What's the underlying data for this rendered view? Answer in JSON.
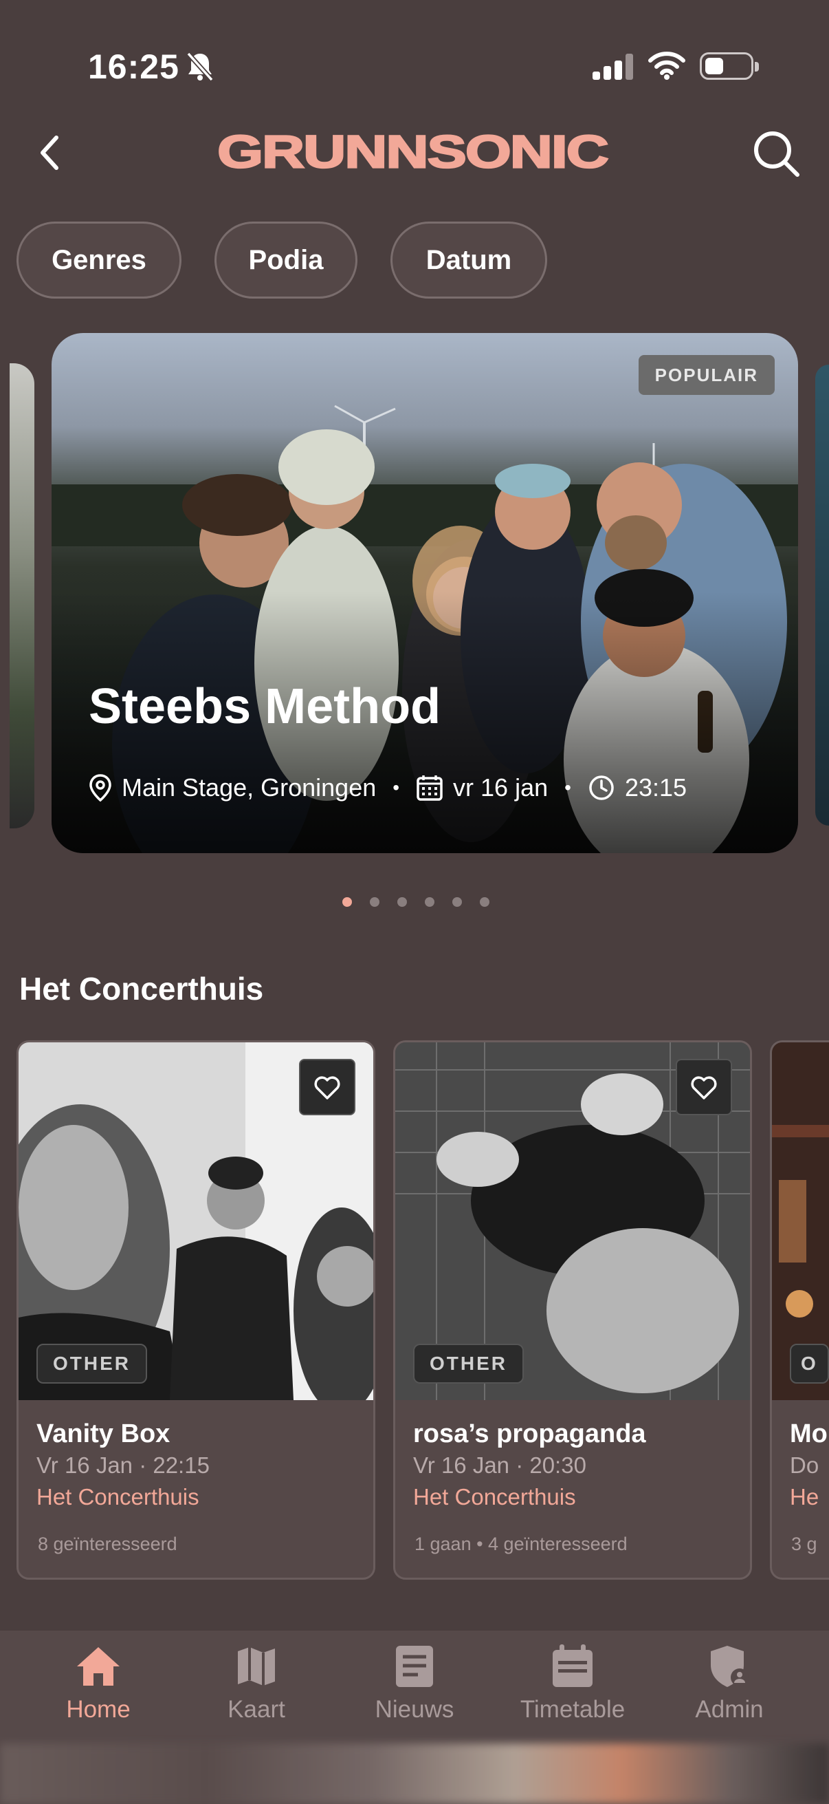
{
  "status_bar": {
    "time": "16:25"
  },
  "header": {
    "logo_text": "GRUNNSONIC"
  },
  "filters": [
    {
      "label": "Genres"
    },
    {
      "label": "Podia"
    },
    {
      "label": "Datum"
    }
  ],
  "featured": {
    "badge": "POPULAIR",
    "title": "Steebs Method",
    "location": "Main Stage, Groningen",
    "date": "vr 16 jan",
    "time": "23:15",
    "page_count": 6,
    "active_page": 1
  },
  "section": {
    "title": "Het Concerthuis",
    "cards": [
      {
        "genre": "OTHER",
        "title": "Vanity Box",
        "when": "Vr 16 Jan · 22:15",
        "venue": "Het Concerthuis",
        "social": "8 geïnteresseerd"
      },
      {
        "genre": "OTHER",
        "title": "rosa’s propaganda",
        "when": "Vr 16 Jan · 20:30",
        "venue": "Het Concerthuis",
        "social": "1 gaan • 4 geïnteresseerd"
      },
      {
        "genre": "O",
        "title": "Mo",
        "when": "Do",
        "venue": "He",
        "social": "3 g"
      }
    ]
  },
  "tabs": [
    {
      "label": "Home",
      "icon": "home-icon",
      "active": true
    },
    {
      "label": "Kaart",
      "icon": "map-icon"
    },
    {
      "label": "Nieuws",
      "icon": "news-icon"
    },
    {
      "label": "Timetable",
      "icon": "calendar-icon"
    },
    {
      "label": "Admin",
      "icon": "admin-shield-icon"
    }
  ],
  "colors": {
    "accent": "#f2a898",
    "background": "#4a3e3e"
  }
}
